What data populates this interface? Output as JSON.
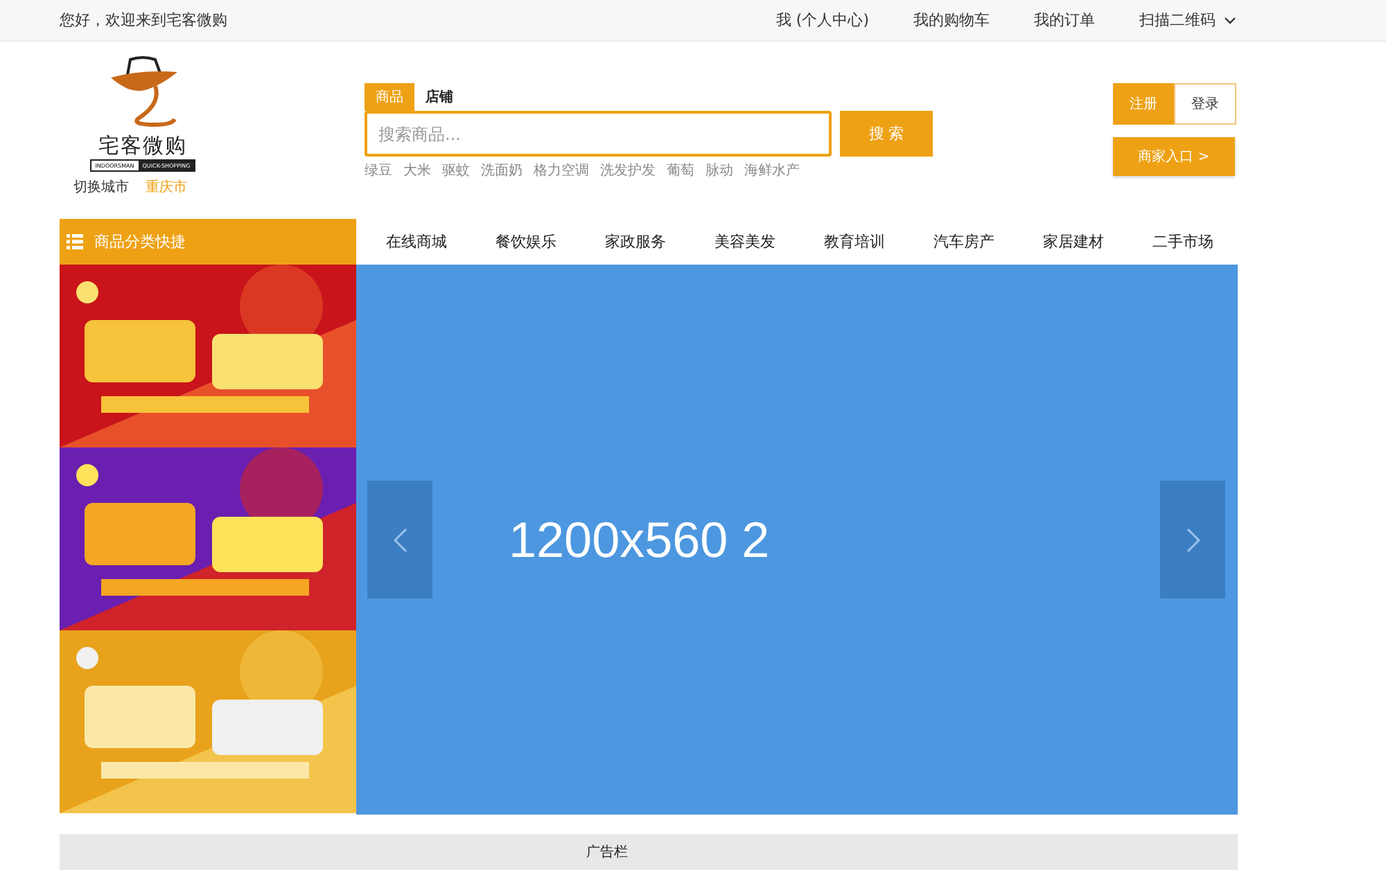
{
  "top_bar": {
    "greeting": "您好，欢迎来到宅客微购",
    "links": [
      "我 (个人中心)",
      "我的购物车",
      "我的订单",
      "扫描二维码"
    ]
  },
  "logo": {
    "name": "宅客微购",
    "tagline_left": "INDOORSMAN",
    "tagline_right": "QUICK-SHOPPING"
  },
  "city": {
    "label": "切换城市",
    "value": "重庆市"
  },
  "search": {
    "tabs": [
      {
        "label": "商品",
        "selected": true
      },
      {
        "label": "店铺",
        "selected": false
      }
    ],
    "placeholder": "搜索商品...",
    "button": "搜 索",
    "hot_words": [
      "绿豆",
      "大米",
      "驱蚊",
      "洗面奶",
      "格力空调",
      "洗发护发",
      "葡萄",
      "脉动",
      "海鲜水产"
    ]
  },
  "account": {
    "register": "注册",
    "login": "登录",
    "merchant": "商家入口 >"
  },
  "category_menu": {
    "label": "商品分类快捷"
  },
  "nav": [
    "在线商城",
    "餐饮娱乐",
    "家政服务",
    "美容美发",
    "教育培训",
    "汽车房产",
    "家居建材",
    "二手市场"
  ],
  "promos": [
    {
      "kind": "picture"
    },
    {
      "kind": "picture"
    },
    {
      "kind": "picture"
    }
  ],
  "carousel": {
    "slide_label": "1200x560 2"
  },
  "ad_section": {
    "title": "广告栏"
  }
}
